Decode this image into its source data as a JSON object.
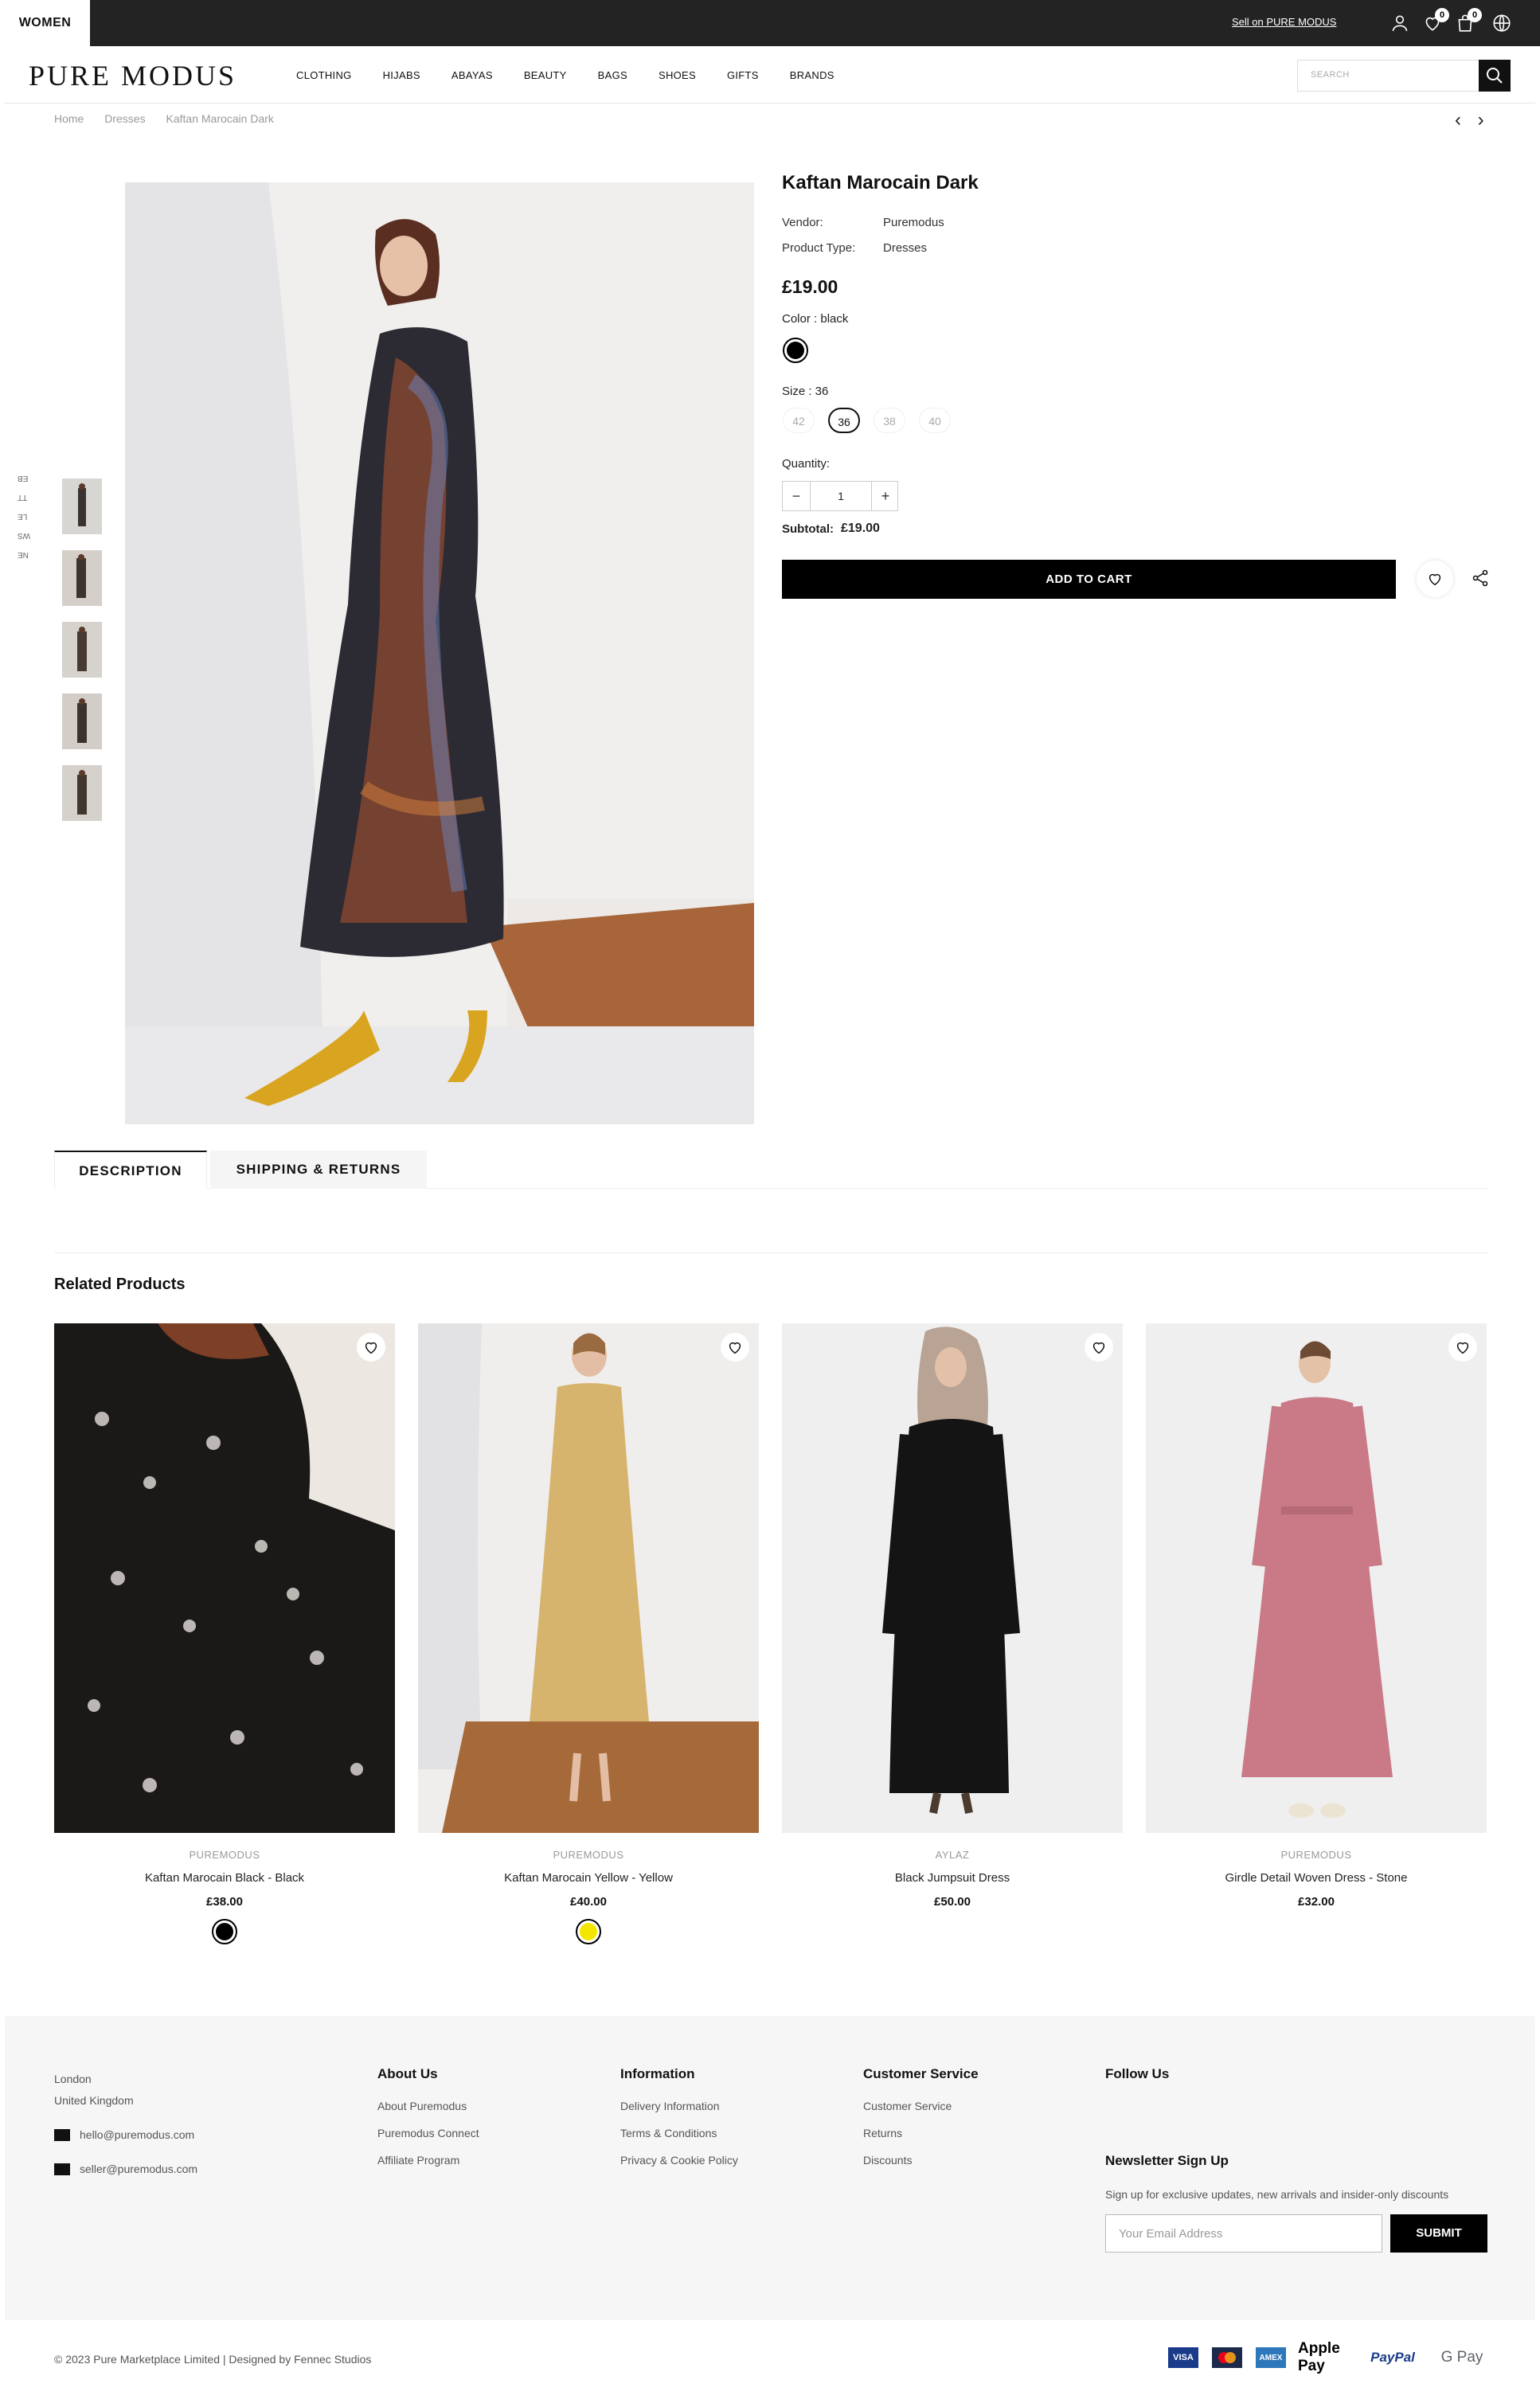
{
  "topbar": {
    "women_label": "WOMEN",
    "sell_link": "Sell on PURE MODUS",
    "wishlist_count": "0",
    "cart_count": "0"
  },
  "header": {
    "logo": "PURE MODUS",
    "search_placeholder": "SEARCH",
    "menu": [
      "CLOTHING",
      "HIJABS",
      "ABAYAS",
      "BEAUTY",
      "BAGS",
      "SHOES",
      "GIFTS",
      "BRANDS"
    ]
  },
  "breadcrumb": [
    "Home",
    "Dresses",
    "Kaftan Marocain Dark"
  ],
  "side_labels": [
    "EB",
    "TT",
    "LE",
    "WS",
    "NE"
  ],
  "product": {
    "title": "Kaftan Marocain Dark",
    "vendor_label": "Vendor:",
    "vendor": "Puremodus",
    "type_label": "Product Type:",
    "type": "Dresses",
    "price": "£19.00",
    "color_label": "Color : black",
    "color_hex": "#000000",
    "size_label": "Size : 36",
    "sizes": [
      "42",
      "36",
      "38",
      "40"
    ],
    "selected_size": "36",
    "quantity_label": "Quantity:",
    "quantity": "1",
    "subtotal_label": "Subtotal:",
    "subtotal": "£19.00",
    "add_to_cart": "ADD TO CART"
  },
  "tabs": [
    "DESCRIPTION",
    "SHIPPING & RETURNS"
  ],
  "related": {
    "title": "Related Products",
    "items": [
      {
        "vendor": "PUREMODUS",
        "name": "Kaftan Marocain Black - Black",
        "price": "£38.00",
        "swatch": "#000000"
      },
      {
        "vendor": "PUREMODUS",
        "name": "Kaftan Marocain Yellow - Yellow",
        "price": "£40.00",
        "swatch": "#f5e600"
      },
      {
        "vendor": "AYLAZ",
        "name": "Black Jumpsuit Dress",
        "price": "£50.00"
      },
      {
        "vendor": "PUREMODUS",
        "name": "Girdle Detail Woven Dress - Stone",
        "price": "£32.00"
      }
    ]
  },
  "footer": {
    "address": [
      "London",
      "United Kingdom"
    ],
    "emails": [
      "hello@puremodus.com",
      "seller@puremodus.com"
    ],
    "about": {
      "title": "About Us",
      "links": [
        "About Puremodus",
        "Puremodus Connect",
        "Affiliate Program"
      ]
    },
    "information": {
      "title": "Information",
      "links": [
        "Delivery Information",
        "Terms & Conditions",
        "Privacy & Cookie Policy"
      ]
    },
    "customer_service": {
      "title": "Customer Service",
      "links": [
        "Customer Service",
        "Returns",
        "Discounts"
      ]
    },
    "follow_title": "Follow Us",
    "newsletter": {
      "title": "Newsletter Sign Up",
      "text": "Sign up for exclusive updates, new arrivals and insider-only discounts",
      "placeholder": "Your Email Address",
      "submit": "SUBMIT"
    },
    "copyright": "© 2023 Pure Marketplace Limited | Designed by Fennec Studios",
    "payments": [
      "VISA",
      "Mastercard",
      "AMEX",
      "Apple Pay",
      "PayPal",
      "G Pay"
    ]
  }
}
